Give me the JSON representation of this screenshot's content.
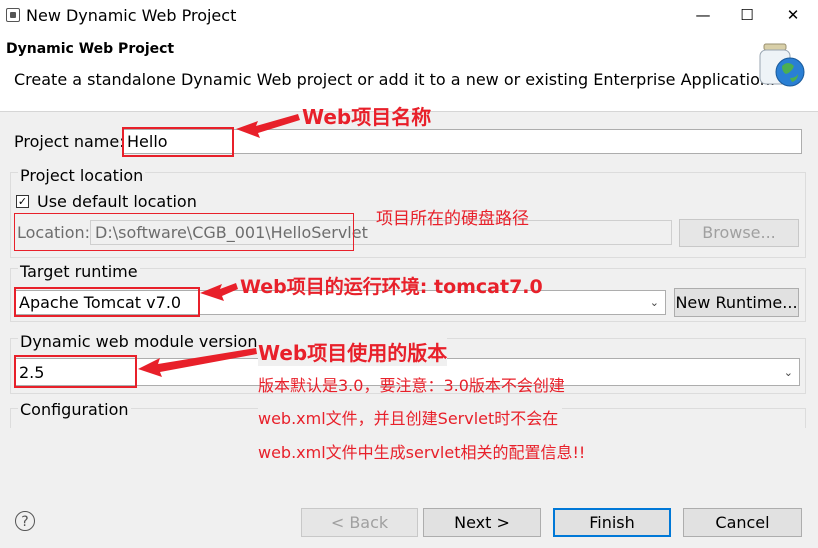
{
  "window": {
    "title": "New Dynamic Web Project",
    "minimize": "—",
    "maximize": "☐",
    "close": "✕"
  },
  "header": {
    "title": "Dynamic Web Project",
    "description": "Create a standalone Dynamic Web project or add it to a new or existing Enterprise Application."
  },
  "project_name": {
    "label": "Project name:",
    "value": "Hello"
  },
  "project_location": {
    "group_label": "Project location",
    "use_default_label": "Use default location",
    "use_default_checked": true,
    "location_label": "Location:",
    "location_value": "D:\\software\\CGB_001\\HelloServlet",
    "browse_label": "Browse..."
  },
  "target_runtime": {
    "group_label": "Target runtime",
    "value": "Apache Tomcat v7.0",
    "new_runtime_label": "New Runtime..."
  },
  "module_version": {
    "group_label": "Dynamic web module version",
    "value": "2.5"
  },
  "configuration": {
    "group_label": "Configuration"
  },
  "annotations": {
    "name": "Web项目名称",
    "location": "项目所在的硬盘路径",
    "runtime": "Web项目的运行环境: tomcat7.0",
    "version_title": "Web项目使用的版本",
    "version_line1": "版本默认是3.0，要注意：3.0版本不会创建",
    "version_line2": "web.xml文件，并且创建Servlet时不会在",
    "version_line3": "web.xml文件中生成servlet相关的配置信息!!"
  },
  "footer": {
    "help": "?",
    "back_label": "< Back",
    "next_label": "Next >",
    "finish_label": "Finish",
    "cancel_label": "Cancel"
  },
  "colors": {
    "annotation_red": "#e8202a",
    "focus_blue": "#0078d7"
  }
}
